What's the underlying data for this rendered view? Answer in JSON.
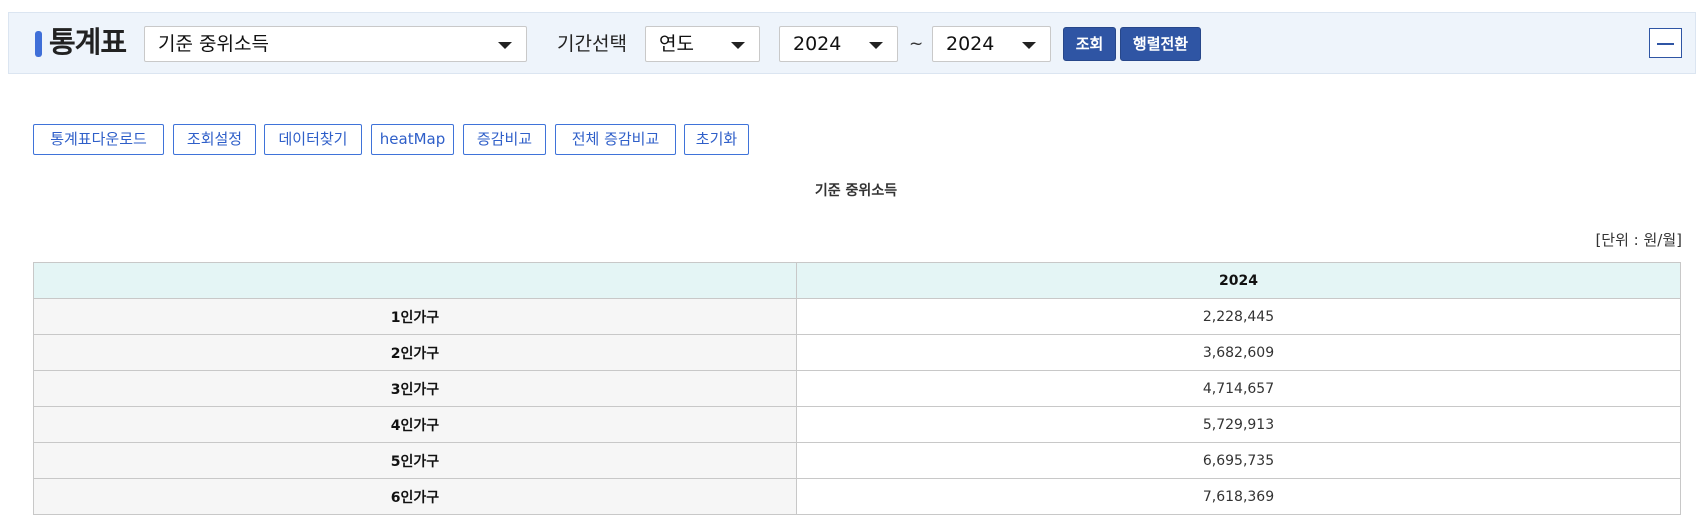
{
  "header": {
    "title": "통계표",
    "stat_select": "기준 중위소득",
    "period_label": "기간선택",
    "period_type": "연도",
    "start_year": "2024",
    "tilde": "~",
    "end_year": "2024",
    "query_button": "조회",
    "pivot_button": "행렬전환"
  },
  "toolbar": {
    "download": "통계표다운로드",
    "settings": "조회설정",
    "find_data": "데이터찾기",
    "heatmap": "heatMap",
    "compare": "증감비교",
    "compare_all": "전체 증감비교",
    "reset": "초기화"
  },
  "table": {
    "title": "기준 중위소득",
    "unit": "[단위 : 원/월]",
    "column_header": "2024",
    "rows": [
      {
        "label": "1인가구",
        "value": "2,228,445"
      },
      {
        "label": "2인가구",
        "value": "3,682,609"
      },
      {
        "label": "3인가구",
        "value": "4,714,657"
      },
      {
        "label": "4인가구",
        "value": "5,729,913"
      },
      {
        "label": "5인가구",
        "value": "6,695,735"
      },
      {
        "label": "6인가구",
        "value": "7,618,369"
      }
    ]
  }
}
